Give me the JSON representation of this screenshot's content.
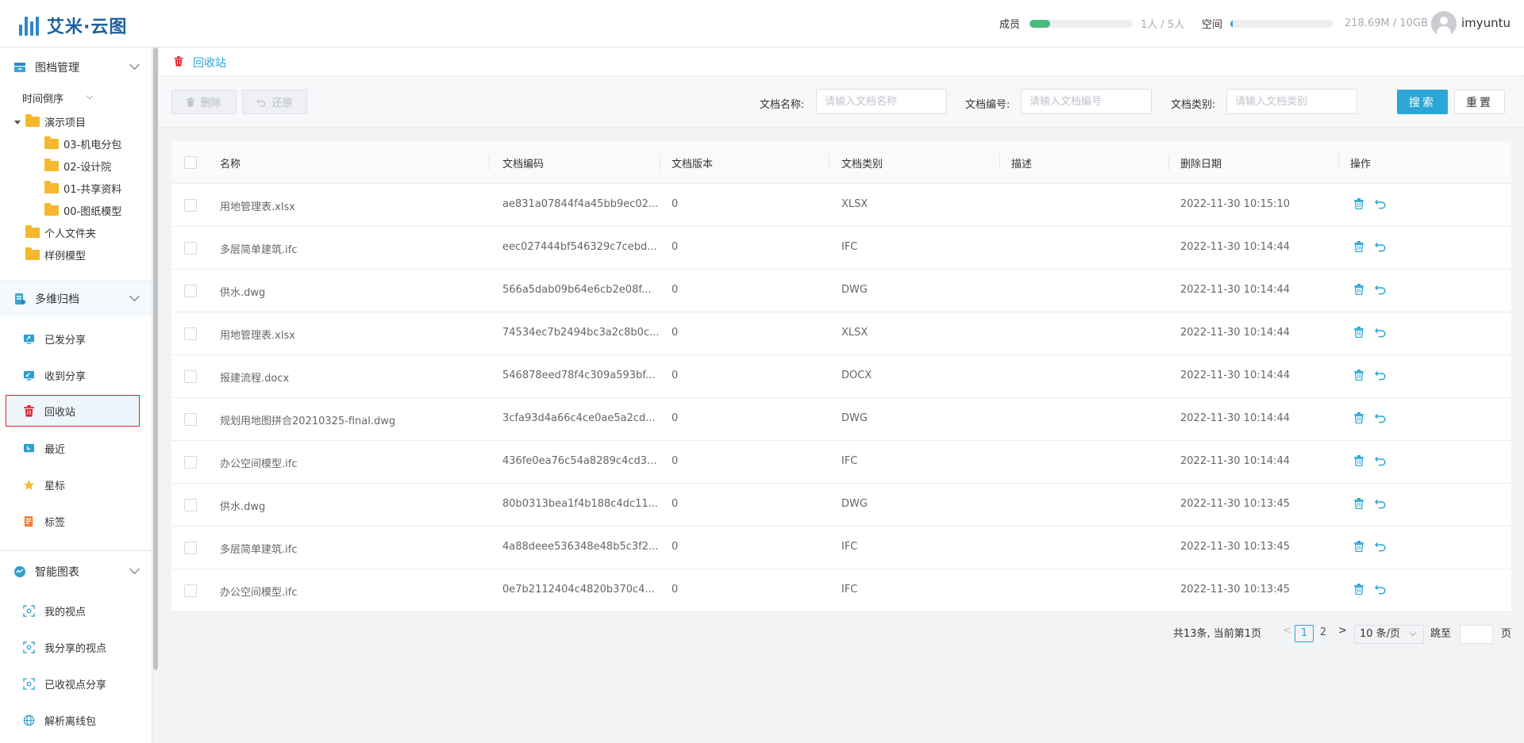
{
  "app": {
    "title": "艾米·云图"
  },
  "header": {
    "members_label": "成员",
    "members_value": "1人 / 5人",
    "members_progress": 0.2,
    "space_label": "空间",
    "space_value": "218.69M / 10GB",
    "space_progress": 0.02,
    "username": "imyuntu",
    "colors": {
      "members_bar": "#4cb87a",
      "space_bar": "#2ca6d6"
    }
  },
  "sidebar": {
    "sections": [
      {
        "label": "图档管理",
        "icon": "archive-icon"
      },
      {
        "label": "多维归档",
        "icon": "multi-archive-icon"
      },
      {
        "label": "智能图表",
        "icon": "smart-chart-icon"
      }
    ],
    "sort_label": "时间倒序",
    "tree": [
      {
        "label": "演示项目",
        "level": 0,
        "expanded": true
      },
      {
        "label": "03-机电分包",
        "level": 1
      },
      {
        "label": "02-设计院",
        "level": 1
      },
      {
        "label": "01-共享资料",
        "level": 1
      },
      {
        "label": "00-图纸模型",
        "level": 1
      },
      {
        "label": "个人文件夹",
        "level": 0
      },
      {
        "label": "样例模型",
        "level": 0
      }
    ],
    "archive_items": [
      {
        "label": "已发分享",
        "icon": "sent-share-icon"
      },
      {
        "label": "收到分享",
        "icon": "received-share-icon"
      },
      {
        "label": "回收站",
        "icon": "trash-icon",
        "active": true
      },
      {
        "label": "最近",
        "icon": "recent-icon"
      },
      {
        "label": "星标",
        "icon": "star-icon"
      },
      {
        "label": "标签",
        "icon": "tag-icon"
      }
    ],
    "chart_items": [
      {
        "label": "我的视点",
        "icon": "viewpoint-icon"
      },
      {
        "label": "我分享的视点",
        "icon": "shared-viewpoint-icon"
      },
      {
        "label": "已收视点分享",
        "icon": "received-viewpoint-icon"
      },
      {
        "label": "解析离线包",
        "icon": "globe-icon"
      }
    ]
  },
  "breadcrumb": {
    "label": "回收站"
  },
  "toolbar": {
    "delete_label": "删除",
    "restore_label": "还原",
    "filters": [
      {
        "label": "文档名称:",
        "placeholder": "请输入文档名称"
      },
      {
        "label": "文档编号:",
        "placeholder": "请输入文档编号"
      },
      {
        "label": "文档类别:",
        "placeholder": "请输入文档类别"
      }
    ],
    "search_label": "搜索",
    "reset_label": "重置"
  },
  "table": {
    "columns": [
      "名称",
      "文档编码",
      "文档版本",
      "文档类别",
      "描述",
      "删除日期",
      "操作"
    ],
    "rows": [
      {
        "name": "用地管理表.xlsx",
        "code": "ae831a07844f4a45bb9ec02...",
        "version": "0",
        "type": "XLSX",
        "desc": "",
        "date": "2022-11-30 10:15:10"
      },
      {
        "name": "多层简单建筑.ifc",
        "code": "eec027444bf546329c7cebd...",
        "version": "0",
        "type": "IFC",
        "desc": "",
        "date": "2022-11-30 10:14:44"
      },
      {
        "name": "供水.dwg",
        "code": "566a5dab09b64e6cb2e08f...",
        "version": "0",
        "type": "DWG",
        "desc": "",
        "date": "2022-11-30 10:14:44"
      },
      {
        "name": "用地管理表.xlsx",
        "code": "74534ec7b2494bc3a2c8b0c...",
        "version": "0",
        "type": "XLSX",
        "desc": "",
        "date": "2022-11-30 10:14:44"
      },
      {
        "name": "报建流程.docx",
        "code": "546878eed78f4c309a593bf...",
        "version": "0",
        "type": "DOCX",
        "desc": "",
        "date": "2022-11-30 10:14:44"
      },
      {
        "name": "规划用地图拼合20210325-final.dwg",
        "code": "3cfa93d4a66c4ce0ae5a2cd...",
        "version": "0",
        "type": "DWG",
        "desc": "",
        "date": "2022-11-30 10:14:44"
      },
      {
        "name": "办公空间模型.ifc",
        "code": "436fe0ea76c54a8289c4cd3...",
        "version": "0",
        "type": "IFC",
        "desc": "",
        "date": "2022-11-30 10:14:44"
      },
      {
        "name": "供水.dwg",
        "code": "80b0313bea1f4b188c4dc11...",
        "version": "0",
        "type": "DWG",
        "desc": "",
        "date": "2022-11-30 10:13:45"
      },
      {
        "name": "多层简单建筑.ifc",
        "code": "4a88deee536348e48b5c3f2...",
        "version": "0",
        "type": "IFC",
        "desc": "",
        "date": "2022-11-30 10:13:45"
      },
      {
        "name": "办公空间模型.ifc",
        "code": "0e7b2112404c4820b370c4...",
        "version": "0",
        "type": "IFC",
        "desc": "",
        "date": "2022-11-30 10:13:45"
      }
    ]
  },
  "pagination": {
    "summary": "共13条, 当前第1页",
    "pages": [
      "1",
      "2"
    ],
    "current": "1",
    "prev": "<",
    "next": ">",
    "page_size": "10 条/页",
    "jump_label": "跳至",
    "page_suffix": "页"
  }
}
